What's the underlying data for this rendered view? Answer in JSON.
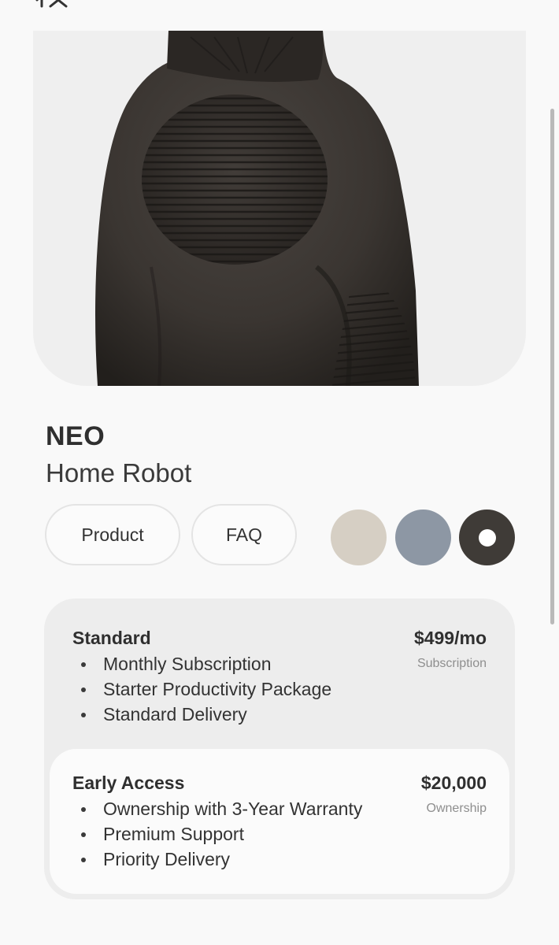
{
  "brand": {
    "logo_icon": "1x-logo-icon"
  },
  "gallery": {
    "slide_count": 7,
    "active_index": 0
  },
  "product": {
    "name": "NEO",
    "subtitle": "Home Robot"
  },
  "nav": {
    "product_label": "Product",
    "faq_label": "FAQ"
  },
  "colors": {
    "options": [
      "#d6cfc4",
      "#8d97a4",
      "#3f3b37"
    ],
    "selected_index": 2
  },
  "plans": {
    "standard": {
      "name": "Standard",
      "price": "$499/mo",
      "type": "Subscription",
      "features": [
        "Monthly Subscription",
        "Starter Productivity Package",
        "Standard Delivery"
      ]
    },
    "early_access": {
      "name": "Early Access",
      "price": "$20,000",
      "type": "Ownership",
      "features": [
        "Ownership with 3-Year Warranty",
        "Premium Support",
        "Priority Delivery"
      ]
    }
  }
}
